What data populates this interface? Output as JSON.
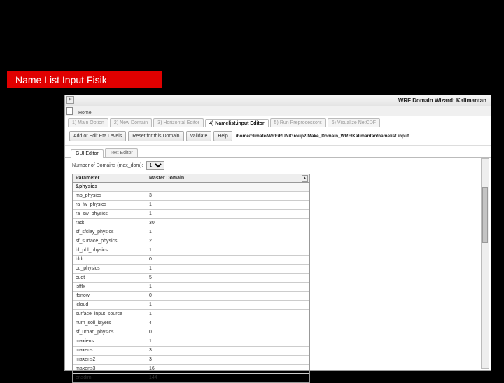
{
  "annotation": {
    "label": "Name List Input Fisik"
  },
  "window": {
    "title": "WRF Domain Wizard: Kalimantan",
    "close_glyph": "×",
    "menu_home": "Home"
  },
  "main_tabs": [
    {
      "label": "1) Main Option"
    },
    {
      "label": "2) New Domain"
    },
    {
      "label": "3) Horizontal Editor"
    },
    {
      "label": "4) Namelist.input Editor"
    },
    {
      "label": "5) Run Preprocessors"
    },
    {
      "label": "6) Visualize NetCDF"
    }
  ],
  "toolbar": {
    "btn1": "Add or Edit Eta Levels",
    "btn2": "Reset for this Domain",
    "btn3": "Validate",
    "btn4": "Help",
    "path": "/home/climate/WRF/RUN/Group2/Make_Domain_WRF/Kalimantan/namelist.input"
  },
  "sub_tabs": [
    {
      "label": "GUI Editor"
    },
    {
      "label": "Text Editor"
    }
  ],
  "domcount": {
    "label": "Number of Domains (max_dom):",
    "value": "1"
  },
  "param_table": {
    "col_param": "Parameter",
    "col_master": "Master Domain",
    "scroll_up_glyph": "▲",
    "rows": [
      {
        "p": "&physics",
        "v": "",
        "section": true
      },
      {
        "p": "mp_physics",
        "v": "3"
      },
      {
        "p": "ra_lw_physics",
        "v": "1"
      },
      {
        "p": "ra_sw_physics",
        "v": "1"
      },
      {
        "p": "radt",
        "v": "30"
      },
      {
        "p": "sf_sfclay_physics",
        "v": "1"
      },
      {
        "p": "sf_surface_physics",
        "v": "2"
      },
      {
        "p": "bl_pbl_physics",
        "v": "1"
      },
      {
        "p": "bldt",
        "v": "0"
      },
      {
        "p": "cu_physics",
        "v": "1"
      },
      {
        "p": "cudt",
        "v": "5"
      },
      {
        "p": "isfflx",
        "v": "1"
      },
      {
        "p": "ifsnow",
        "v": "0"
      },
      {
        "p": "icloud",
        "v": "1"
      },
      {
        "p": "surface_input_source",
        "v": "1"
      },
      {
        "p": "num_soil_layers",
        "v": "4"
      },
      {
        "p": "sf_urban_physics",
        "v": "0"
      },
      {
        "p": "maxiens",
        "v": "1"
      },
      {
        "p": "maxens",
        "v": "3"
      },
      {
        "p": "maxens2",
        "v": "3"
      },
      {
        "p": "maxens3",
        "v": "16"
      },
      {
        "p": "ensdim",
        "v": "144"
      }
    ]
  }
}
